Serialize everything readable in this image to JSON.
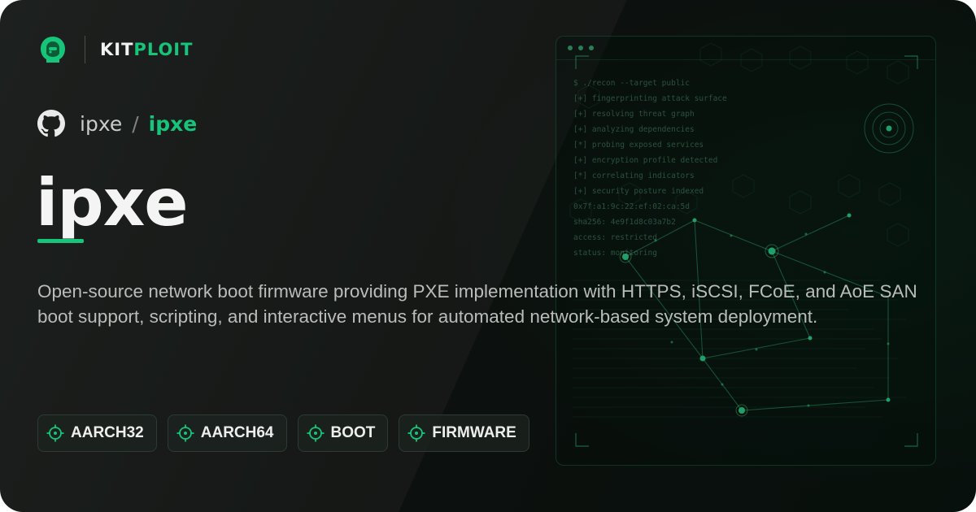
{
  "brand": {
    "logo_icon": "kitploit-hacker-logo-icon",
    "name_part1": "KIT",
    "name_part2": "PLOIT"
  },
  "repo": {
    "icon": "github-icon",
    "owner": "ipxe",
    "separator": "/",
    "name": "ipxe"
  },
  "title": "ipxe",
  "description": "Open-source network boot firmware providing PXE implementation with HTTPS, iSCSI, FCoE, and AoE SAN boot support, scripting, and interactive menus for automated network-based system deployment.",
  "tags": [
    {
      "label": "AARCH32",
      "icon": "crosshair-icon"
    },
    {
      "label": "AARCH64",
      "icon": "crosshair-icon"
    },
    {
      "label": "BOOT",
      "icon": "crosshair-icon"
    },
    {
      "label": "FIRMWARE",
      "icon": "crosshair-icon"
    }
  ],
  "terminal": {
    "lines": [
      "$ ./recon --target public",
      "[+] fingerprinting attack surface",
      "[+] resolving threat graph",
      "[+] analyzing dependencies",
      "[*] probing exposed services",
      "[+] encryption profile detected",
      "[*] correlating indicators",
      "[+] security posture indexed",
      "0x7f:a1:9c:22:ef:02:ca:5d",
      "sha256: 4e9f1d8c03a7b2",
      "access: restricted",
      "status: monitoring"
    ]
  },
  "colors": {
    "accent": "#16c47a",
    "background": "#0d100e",
    "text": "#f4f4f4",
    "muted_text": "#b9bcbb"
  }
}
